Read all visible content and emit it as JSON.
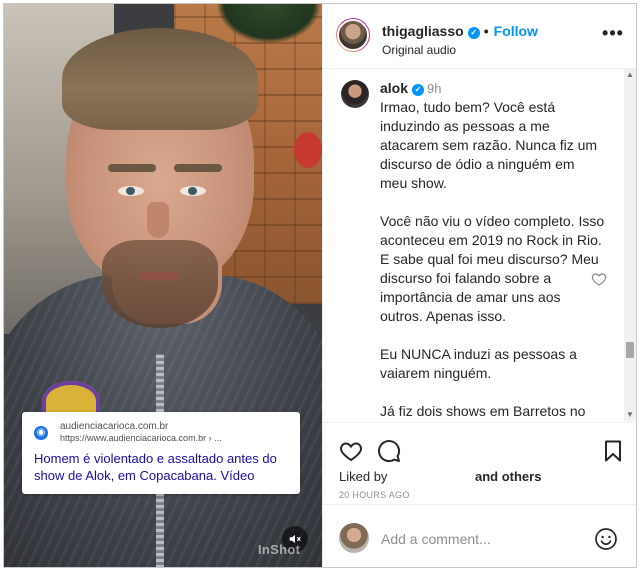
{
  "post": {
    "media": {
      "news_card": {
        "domain": "audienciacarioca.com.br",
        "url": "https://www.audienciacarioca.com.br › ...",
        "headline": "Homem é violentado e assaltado antes do show de Alok, em Copacabana. Vídeo"
      },
      "watermark": "InShot",
      "mute_icon": "speaker-muted-icon"
    },
    "header": {
      "username": "thigagliasso",
      "verified": true,
      "separator": "•",
      "follow_label": "Follow",
      "subtitle": "Original audio",
      "more_icon": "more-options-icon",
      "more_label": "•••"
    },
    "comment": {
      "username": "alok",
      "verified": true,
      "time": "9h",
      "text": "Irmao, tudo bem? Você está induzindo as pessoas a me atacarem sem razão. Nunca fiz um discurso de ódio a ninguém em meu show.\n\nVocê não viu o vídeo completo. Isso aconteceu em 2019 no Rock in Rio. E sabe qual foi meu discurso? Meu discurso foi falando sobre a importância de amar uns aos outros. Apenas isso.\n\nEu NUNCA induzi as pessoas a vaiarem ninguém.\n\nJá fiz dois shows em Barretos no mesmo dia em que o Bolsonaro esteve presente. Sempre foi feito com muita tranquilidade.",
      "like_icon": "heart-outline-icon"
    },
    "actions": {
      "like_icon": "heart-outline-icon",
      "comment_icon": "comment-bubble-icon",
      "save_icon": "bookmark-icon",
      "liked_by": "Liked by",
      "and_others": "and others",
      "timestamp": "20 HOURS AGO"
    },
    "add_comment": {
      "placeholder": "Add a comment...",
      "emoji_icon": "emoji-smile-icon"
    }
  },
  "colors": {
    "accent_blue": "#0095f6",
    "text_primary": "#262626",
    "text_secondary": "#8e8e8e",
    "link_blue": "#1a0dab"
  }
}
